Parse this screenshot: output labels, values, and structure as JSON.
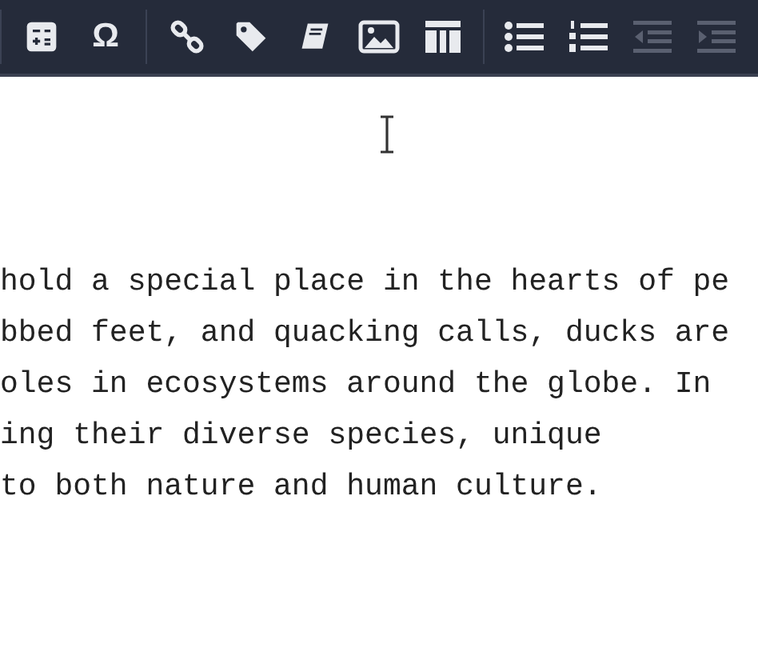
{
  "toolbar": {
    "groups": [
      [
        {
          "kind": "calculator",
          "disabled": false
        },
        {
          "kind": "symbol",
          "label": "Ω",
          "disabled": false
        }
      ],
      [
        {
          "kind": "link",
          "disabled": false
        },
        {
          "kind": "tag",
          "disabled": false
        },
        {
          "kind": "book",
          "disabled": false
        },
        {
          "kind": "image",
          "disabled": false
        },
        {
          "kind": "table",
          "disabled": false
        }
      ],
      [
        {
          "kind": "bullet-list",
          "disabled": false
        },
        {
          "kind": "numbered-list",
          "disabled": false
        },
        {
          "kind": "outdent",
          "disabled": true
        },
        {
          "kind": "indent",
          "disabled": true
        }
      ]
    ]
  },
  "editor": {
    "lines": [
      "hold a special place in the hearts of pe",
      "bbed feet, and quacking calls, ducks are",
      "oles in ecosystems around the globe. In",
      "ing their diverse species, unique",
      "to both nature and human culture."
    ]
  }
}
